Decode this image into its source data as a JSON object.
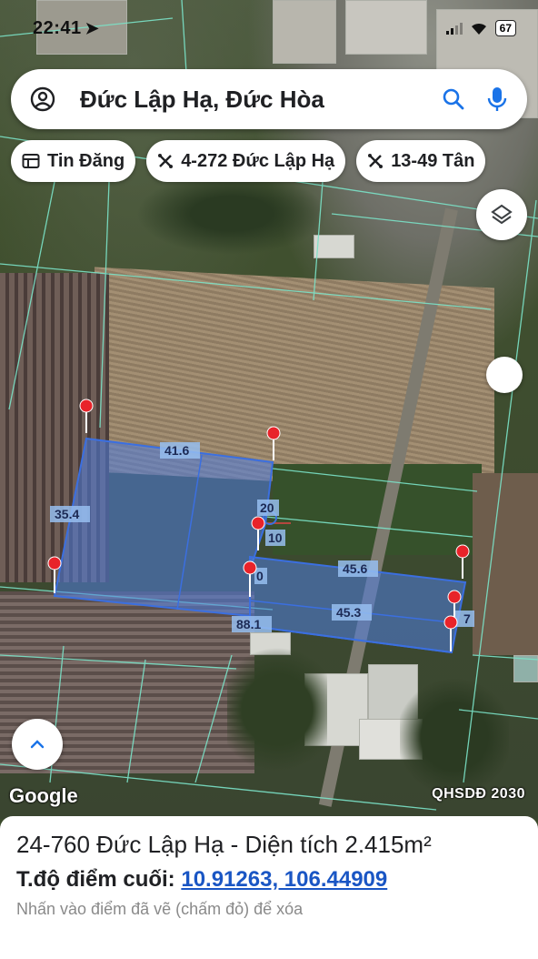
{
  "status_bar": {
    "time": "22:41",
    "battery": "67"
  },
  "search": {
    "title": "Đức Lập Hạ, Đức Hòa",
    "left_icon": "account-circle-icon",
    "search_icon": "search-icon",
    "mic_icon": "mic-icon"
  },
  "chips": [
    {
      "label": "Tin Đăng",
      "icon": "listing-icon"
    },
    {
      "label": "4-272 Đức Lập Hạ",
      "icon": "parcel-icon"
    },
    {
      "label": "13-49 Tân",
      "icon": "parcel-icon"
    }
  ],
  "map": {
    "layers_icon": "layers-icon",
    "expand_icon": "chevron-up-icon",
    "provider": "Google",
    "plan_label": "QHSDĐ 2030",
    "measurements": [
      "41.6",
      "35.4",
      "20",
      "10",
      "45.6",
      "0",
      "45.3",
      "88.1",
      "7"
    ],
    "colors": {
      "polygon_fill": "#4f7ee0",
      "polygon_stroke": "#3b6fe0",
      "marker": "#e8232a"
    }
  },
  "sheet": {
    "parcel_title": "24-760 Đức Lập Hạ - Diện tích 2.415m²",
    "coords_label": "T.độ điểm cuối:",
    "coords_value": "10.91263, 106.44909",
    "hint": "Nhấn vào điểm đã vẽ (chấm đỏ) để xóa"
  }
}
